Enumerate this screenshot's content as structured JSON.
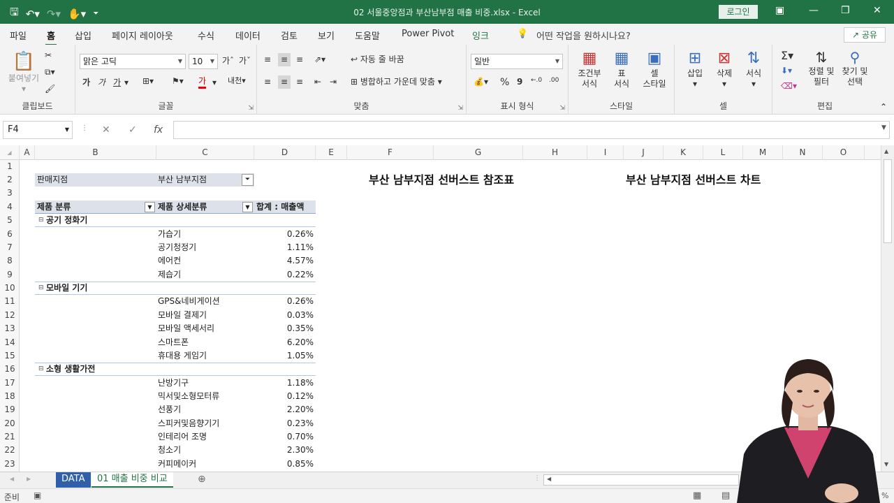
{
  "title_bar": {
    "doc_title": "02 서울중앙점과 부산남부점 매출 비중.xlsx  -  Excel",
    "login_label": "로그인"
  },
  "menu": {
    "tabs": [
      "파일",
      "홈",
      "삽입",
      "페이지 레이아웃",
      "수식",
      "데이터",
      "검토",
      "보기",
      "도움말",
      "Power Pivot",
      "잉크"
    ],
    "tell_me": "어떤 작업을 원하시나요?",
    "share": "공유"
  },
  "ribbon": {
    "clipboard": {
      "paste": "붙여넣기",
      "label": "클립보드"
    },
    "font": {
      "name": "맑은 고딕",
      "size": "10",
      "label": "글꼴",
      "bold": "가",
      "italic": "가",
      "underline": "가",
      "grow": "가",
      "shrink": "가",
      "text_color": "가",
      "phonetic": "내천"
    },
    "alignment": {
      "wrap": "자동 줄 바꿈",
      "merge": "병합하고 가운데 맞춤",
      "label": "맞춤"
    },
    "number": {
      "format": "일반",
      "label": "표시 형식",
      "percent": "%",
      "comma": "9"
    },
    "styles": {
      "conditional": "조건부\n서식",
      "table": "표\n서식",
      "cell": "셀\n스타일",
      "label": "스타일"
    },
    "cells": {
      "insert": "삽입",
      "delete": "삭제",
      "format": "서식",
      "label": "셀"
    },
    "editing": {
      "sort": "정렬 및\n필터",
      "find": "찾기 및\n선택",
      "label": "편집"
    }
  },
  "formula_bar": {
    "name_box": "F4",
    "value": ""
  },
  "columns": [
    "A",
    "B",
    "C",
    "D",
    "E",
    "F",
    "G",
    "H",
    "I",
    "J",
    "K",
    "L",
    "M",
    "N",
    "O"
  ],
  "rows": [
    "1",
    "2",
    "3",
    "4",
    "5",
    "6",
    "7",
    "8",
    "9",
    "10",
    "11",
    "12",
    "13",
    "14",
    "15",
    "16",
    "17",
    "18",
    "19",
    "20",
    "21",
    "22",
    "23"
  ],
  "pivot": {
    "filter_label": "판매지점",
    "filter_value": "부산 남부지점",
    "header_category": "제품 분류",
    "header_subcategory": "제품 상세분류",
    "header_sum": "합계 : 매출액",
    "groups": [
      {
        "name": "공기 정화기",
        "items": [
          [
            "가습기",
            "0.26%"
          ],
          [
            "공기청정기",
            "1.11%"
          ],
          [
            "에어컨",
            "4.57%"
          ],
          [
            "제습기",
            "0.22%"
          ]
        ]
      },
      {
        "name": "모바일 기기",
        "items": [
          [
            "GPS&네비게이션",
            "0.26%"
          ],
          [
            "모바일 결제기",
            "0.03%"
          ],
          [
            "모바일 액세서리",
            "0.35%"
          ],
          [
            "스마트폰",
            "6.20%"
          ],
          [
            "휴대용 게임기",
            "1.05%"
          ]
        ]
      },
      {
        "name": "소형 생활가전",
        "items": [
          [
            "난방기구",
            "1.18%"
          ],
          [
            "믹서및소형모터류",
            "0.12%"
          ],
          [
            "선풍기",
            "2.20%"
          ],
          [
            "스피커및음향기기",
            "0.23%"
          ],
          [
            "인테리어 조명",
            "0.70%"
          ],
          [
            "청소기",
            "2.30%"
          ],
          [
            "커피메이커",
            "0.85%"
          ]
        ]
      }
    ]
  },
  "headings": {
    "table_title": "부산 남부지점 선버스트 참조표",
    "chart_title": "부산 남부지점 선버스트 차트"
  },
  "sheets": {
    "tab1": "DATA",
    "tab2": "01 매출 비중 비교"
  },
  "status": {
    "ready": "준비",
    "zoom_pct": "%"
  },
  "colors": {
    "excel_green": "#217346",
    "data_tab": "#2e5fa8"
  }
}
